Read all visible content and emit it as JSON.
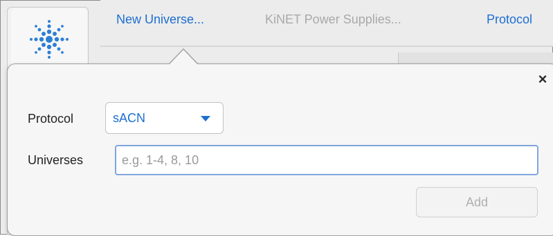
{
  "toolbar": {
    "tabs": [
      {
        "label": "New Universe...",
        "state": "active"
      },
      {
        "label": "KiNET Power Supplies...",
        "state": "disabled"
      },
      {
        "label": "Protocol",
        "state": "active"
      }
    ]
  },
  "popover": {
    "close_icon": "×",
    "protocol_label": "Protocol",
    "protocol_value": "sACN",
    "universes_label": "Universes",
    "universes_value": "",
    "universes_placeholder": "e.g. 1-4, 8, 10",
    "add_label": "Add"
  },
  "colors": {
    "accent": "#1d6fd0",
    "disabled_text": "#a9a9a9",
    "focus_ring": "#7fa6de"
  },
  "icons": {
    "app_logo": "starburst-logo-icon",
    "close": "close-icon",
    "dropdown": "chevron-down-icon"
  }
}
